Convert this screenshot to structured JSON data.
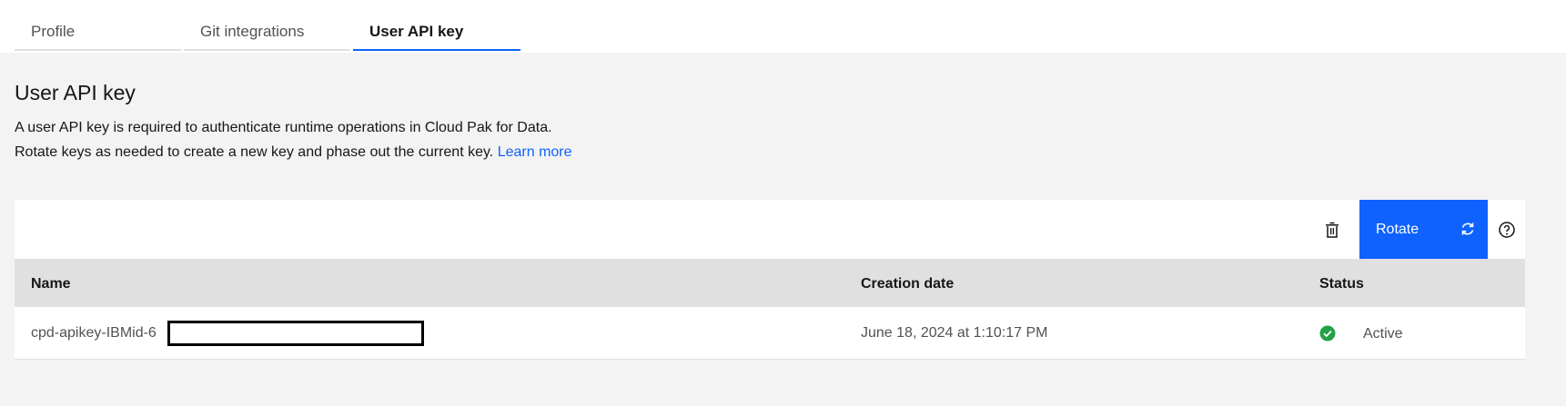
{
  "tabs": [
    {
      "label": "Profile",
      "active": false
    },
    {
      "label": "Git integrations",
      "active": false
    },
    {
      "label": "User API key",
      "active": true
    }
  ],
  "section": {
    "title": "User API key",
    "description_line1": "A user API key is required to authenticate runtime operations in Cloud Pak for Data.",
    "description_line2": "Rotate keys as needed to create a new key and phase out the current key.",
    "learn_more_link": "Learn more"
  },
  "toolbar": {
    "delete_icon": "trash-icon",
    "rotate_label": "Rotate",
    "rotate_icon": "renew-icon",
    "help_icon": "help-icon"
  },
  "table": {
    "columns": [
      "Name",
      "Creation date",
      "Status"
    ],
    "rows": [
      {
        "name": "cpd-apikey-IBMid-6",
        "creation_date": "June 18, 2024 at 1:10:17 PM",
        "status": "Active",
        "status_icon": "checkmark-filled-icon"
      }
    ]
  },
  "colors": {
    "accent": "#0f62fe",
    "success": "#24a148",
    "background": "#f3f3f3",
    "header_bg": "#e0e0e0"
  }
}
